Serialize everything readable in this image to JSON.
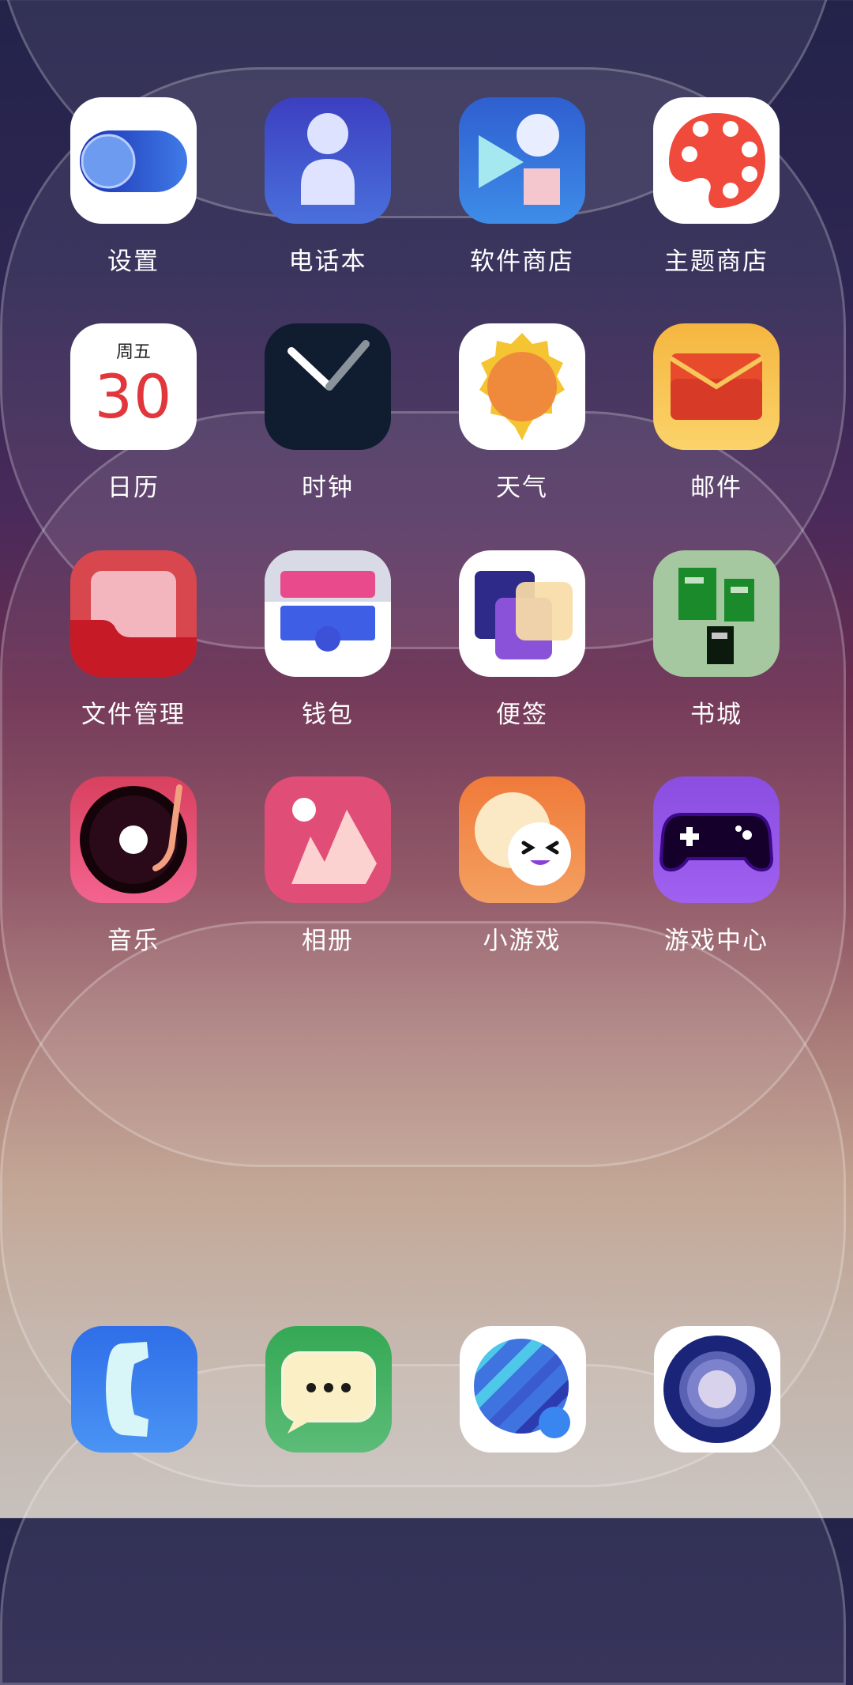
{
  "home_screen": {
    "apps": [
      {
        "label": "设置",
        "icon": "settings-toggle-icon"
      },
      {
        "label": "电话本",
        "icon": "contacts-person-icon"
      },
      {
        "label": "软件商店",
        "icon": "app-store-icon"
      },
      {
        "label": "主题商店",
        "icon": "palette-icon"
      },
      {
        "label": "日历",
        "icon": "calendar-icon"
      },
      {
        "label": "时钟",
        "icon": "clock-icon"
      },
      {
        "label": "天气",
        "icon": "sun-icon"
      },
      {
        "label": "邮件",
        "icon": "envelope-icon"
      },
      {
        "label": "文件管理",
        "icon": "folder-icon"
      },
      {
        "label": "钱包",
        "icon": "wallet-icon"
      },
      {
        "label": "便签",
        "icon": "notes-icon"
      },
      {
        "label": "书城",
        "icon": "books-icon"
      },
      {
        "label": "音乐",
        "icon": "vinyl-record-icon"
      },
      {
        "label": "相册",
        "icon": "mountain-photo-icon"
      },
      {
        "label": "小游戏",
        "icon": "smiley-face-icon"
      },
      {
        "label": "游戏中心",
        "icon": "gamepad-icon"
      }
    ],
    "calendar_icon": {
      "weekday": "周五",
      "date": "30"
    },
    "dock": [
      {
        "icon": "phone-handset-icon"
      },
      {
        "icon": "chat-bubble-icon"
      },
      {
        "icon": "browser-globe-icon"
      },
      {
        "icon": "camera-lens-icon"
      }
    ]
  }
}
